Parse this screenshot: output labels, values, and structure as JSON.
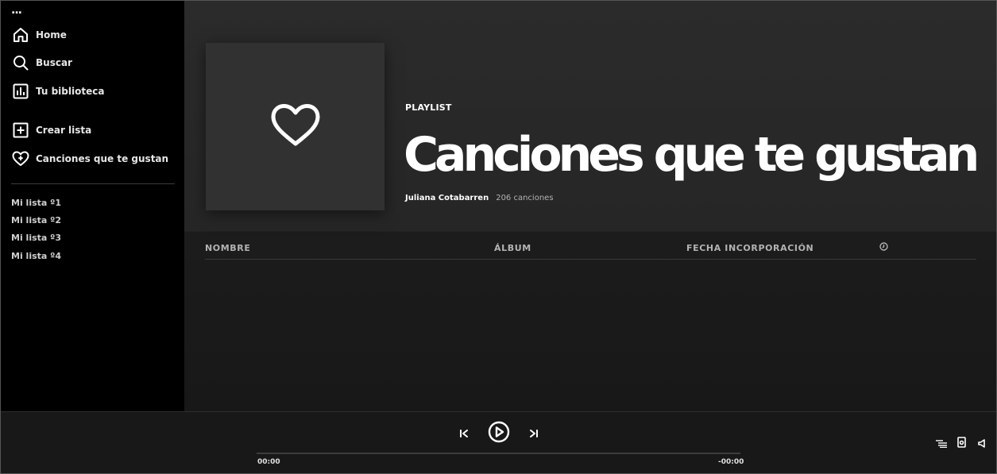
{
  "sidebar": {
    "more_label": "...",
    "nav": [
      {
        "label": "Home",
        "icon": "home-icon"
      },
      {
        "label": "Buscar",
        "icon": "search-icon"
      },
      {
        "label": "Tu biblioteca",
        "icon": "library-icon"
      }
    ],
    "actions": [
      {
        "label": "Crear lista",
        "icon": "plus-square-icon"
      },
      {
        "label": "Canciones que te gustan",
        "icon": "heart-plus-icon"
      }
    ],
    "playlists": [
      "Mi lista º1",
      "Mi lista º2",
      "Mi lista º3",
      "Mi lista º4"
    ]
  },
  "header": {
    "type": "PLAYLIST",
    "title": "Canciones que te gustan",
    "owner": "Juliana Cotabarren",
    "song_count": "206 canciones",
    "cover_icon": "heart-icon"
  },
  "table": {
    "columns": [
      "NOMBRE",
      "ÁLBUM",
      "FECHA INCORPORACIÓN"
    ],
    "duration_icon": "clock-icon"
  },
  "player": {
    "elapsed": "00:00",
    "remaining": "-00:00",
    "progress": 0,
    "icons": [
      "previous-icon",
      "play-icon",
      "next-icon",
      "queue-icon",
      "device-icon",
      "volume-icon"
    ]
  },
  "colors": {
    "background": "#000000",
    "main_header": "#2b2b2b",
    "cover": "#313131",
    "player": "#181818"
  }
}
